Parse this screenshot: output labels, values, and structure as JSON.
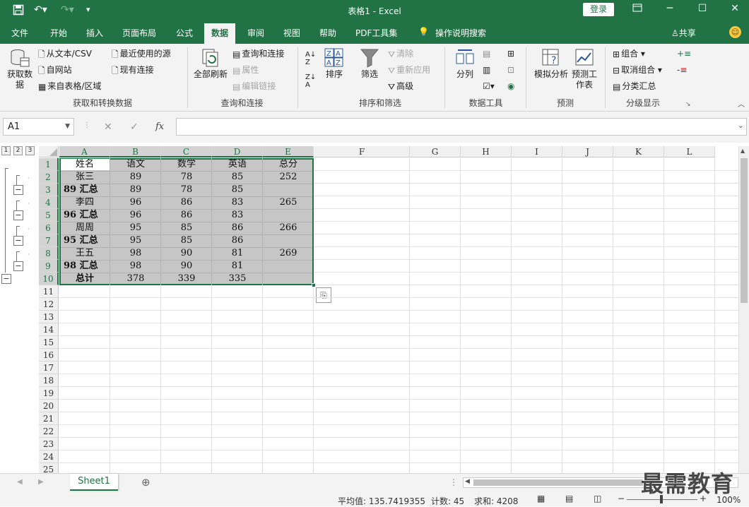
{
  "window": {
    "title": "表格1 - Excel",
    "login_label": "登录"
  },
  "ribbon_tabs": [
    "文件",
    "开始",
    "插入",
    "页面布局",
    "公式",
    "数据",
    "审阅",
    "视图",
    "帮助",
    "PDF工具集",
    "操作说明搜索"
  ],
  "active_tab": "数据",
  "share_label": "共享",
  "ribbon": {
    "get_data": "获取数据",
    "from_text": "从文本/CSV",
    "from_web": "自网站",
    "from_table": "来自表格/区域",
    "recent_sources": "最近使用的源",
    "existing_conn": "现有连接",
    "group_get": "获取和转换数据",
    "refresh_all": "全部刷新",
    "queries_conn": "查询和连接",
    "properties": "属性",
    "edit_links": "编辑链接",
    "group_query": "查询和连接",
    "sort": "排序",
    "filter": "筛选",
    "clear": "清除",
    "reapply": "重新应用",
    "advanced": "高级",
    "group_sort": "排序和筛选",
    "text_to_col": "分列",
    "group_tools": "数据工具",
    "what_if": "模拟分析",
    "forecast_sheet": "预测工作表",
    "group_forecast": "预测",
    "group_btn": "组合",
    "ungroup_btn": "取消组合",
    "subtotal_btn": "分类汇总",
    "group_outline": "分级显示"
  },
  "formula_bar": {
    "name_box": "A1",
    "fx": "fx",
    "content": ""
  },
  "outline_levels": [
    "1",
    "2",
    "3"
  ],
  "columns": [
    "A",
    "B",
    "C",
    "D",
    "E",
    "F",
    "G",
    "H",
    "I",
    "J",
    "K",
    "L"
  ],
  "rows": [
    "1",
    "2",
    "3",
    "4",
    "5",
    "6",
    "7",
    "8",
    "9",
    "10",
    "11",
    "12",
    "13",
    "14",
    "15",
    "16",
    "17",
    "18",
    "19",
    "20",
    "21",
    "22",
    "23",
    "24",
    "25"
  ],
  "table": [
    [
      "姓名",
      "语文",
      "数学",
      "英语",
      "总分"
    ],
    [
      "张三",
      "89",
      "78",
      "85",
      "252"
    ],
    [
      "89 汇总",
      "89",
      "78",
      "85",
      ""
    ],
    [
      "李四",
      "96",
      "86",
      "83",
      "265"
    ],
    [
      "96 汇总",
      "96",
      "86",
      "83",
      ""
    ],
    [
      "周周",
      "95",
      "85",
      "86",
      "266"
    ],
    [
      "95 汇总",
      "95",
      "85",
      "86",
      ""
    ],
    [
      "王五",
      "98",
      "90",
      "81",
      "269"
    ],
    [
      "98 汇总",
      "98",
      "90",
      "81",
      ""
    ],
    [
      "总计",
      "378",
      "339",
      "335",
      ""
    ]
  ],
  "sheet_tab": "Sheet1",
  "status": {
    "average": "平均值: 135.7419355",
    "count": "计数: 45",
    "sum": "求和: 4208",
    "zoom": "100%"
  },
  "watermark": "最需教育",
  "colors": {
    "accent": "#217346",
    "selection": "#c6c6c6"
  }
}
